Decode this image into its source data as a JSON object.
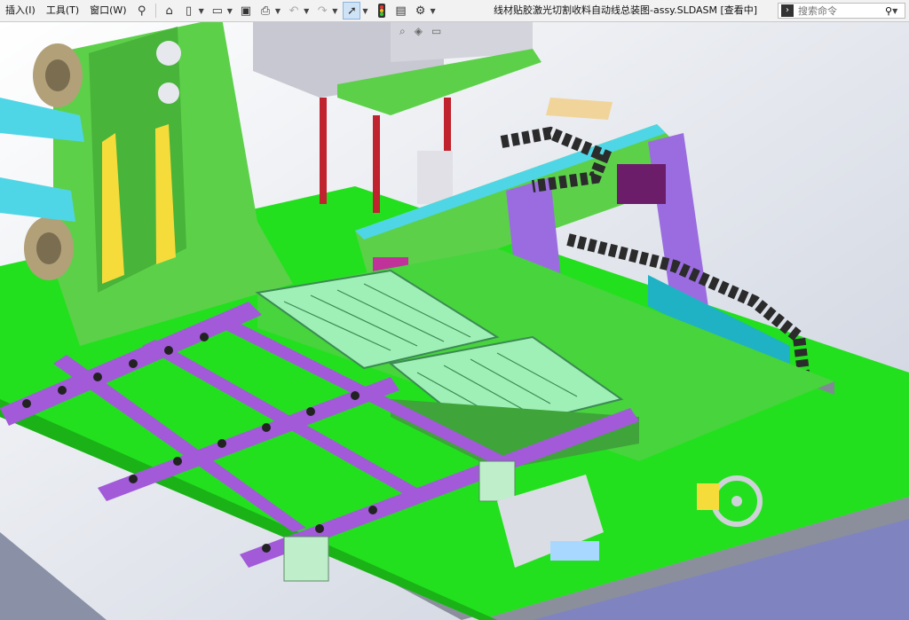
{
  "menu": {
    "insert": "插入(I)",
    "tools": "工具(T)",
    "window": "窗口(W)"
  },
  "window_title": "线材贴胶激光切割收料自动线总装图-assy.SLDASM [查看中]",
  "search": {
    "placeholder": "搜索命令"
  },
  "icons": {
    "pin": "pin-icon",
    "home": "home-icon",
    "new": "new-document-icon",
    "open": "open-folder-icon",
    "save": "save-icon",
    "print": "print-icon",
    "undo": "undo-icon",
    "redo": "redo-icon",
    "select": "select-cursor-icon",
    "traffic": "rebuild-traffic-light-icon",
    "file_props": "file-properties-icon",
    "options": "gear-icon",
    "command": "command-prompt-icon",
    "search": "search-icon",
    "help": "help-icon"
  },
  "colors": {
    "plate_green": "#22e01d",
    "frame_green": "#5dd04a",
    "purple": "#a25ad9",
    "gantry_purple": "#9a6ce0",
    "tray": "#9ff0b6",
    "cyan": "#4fd6e6",
    "background": "#e6e8ee"
  }
}
